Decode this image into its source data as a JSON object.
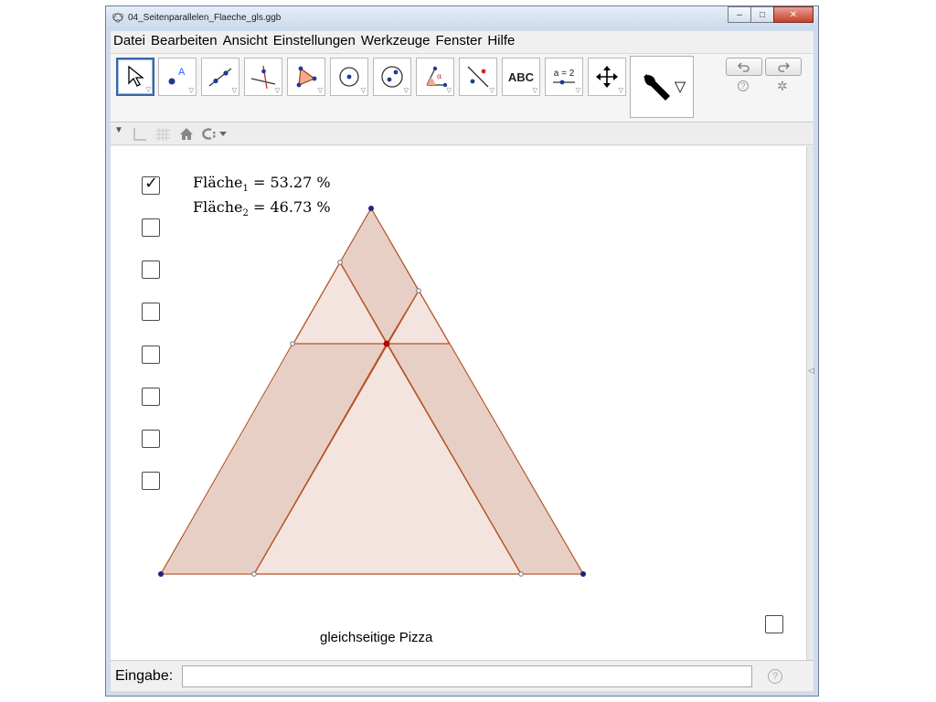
{
  "window": {
    "title": "04_Seitenparallelen_Flaeche_gls.ggb",
    "minimize": "–",
    "maximize": "□",
    "close": "✕"
  },
  "menubar": {
    "items": [
      "Datei",
      "Bearbeiten",
      "Ansicht",
      "Einstellungen",
      "Werkzeuge",
      "Fenster",
      "Hilfe"
    ]
  },
  "toolbar": {
    "tools": [
      {
        "name": "move-tool",
        "icon": "arrow-pointer-icon"
      },
      {
        "name": "point-tool",
        "icon": "point-icon"
      },
      {
        "name": "line-tool",
        "icon": "line-icon"
      },
      {
        "name": "perpendicular-tool",
        "icon": "perpendicular-icon"
      },
      {
        "name": "polygon-tool",
        "icon": "polygon-icon"
      },
      {
        "name": "circle-tool",
        "icon": "circle-center-icon"
      },
      {
        "name": "ellipse-tool",
        "icon": "ellipse-icon"
      },
      {
        "name": "angle-tool",
        "icon": "angle-icon"
      },
      {
        "name": "reflect-tool",
        "icon": "reflect-icon"
      },
      {
        "name": "text-tool",
        "label": "ABC"
      },
      {
        "name": "slider-tool",
        "label": "a = 2"
      },
      {
        "name": "move-view-tool",
        "icon": "move-view-icon"
      }
    ],
    "undo_icon": "undo-icon",
    "redo_icon": "redo-icon",
    "help": "?",
    "settings_icon": "gear-icon"
  },
  "graphics": {
    "formula1": {
      "label": "Fläche",
      "sub": "1",
      "value": "= 53.27 %"
    },
    "formula2": {
      "label": "Fläche",
      "sub": "2",
      "value": "= 46.73 %"
    },
    "caption": "gleichseitige Pizza",
    "checkboxes": [
      true,
      false,
      false,
      false,
      false,
      false,
      false,
      false
    ]
  },
  "inputbar": {
    "label": "Eingabe:",
    "value": "",
    "help": "?"
  },
  "colors": {
    "triangle_fill": "#f3e4df",
    "band_fill": "#e7cfc6",
    "edge": "#b5501f",
    "vertex": "#1a237e",
    "center_point": "#cc0000"
  }
}
